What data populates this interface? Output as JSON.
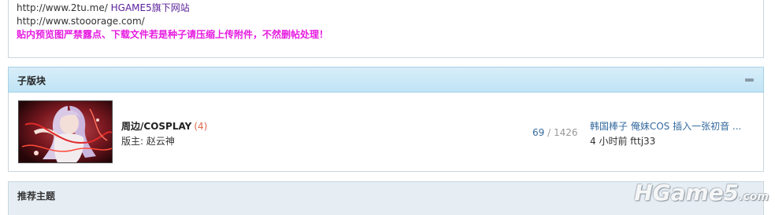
{
  "notice": {
    "line1_url": "http://www.2tu.me/",
    "line1_label": "HGAME5旗下网站",
    "line2_url": "http://www.stooorage.com/",
    "warning": "贴内预览图严禁露点、下载文件若是种子请压缩上传附件，不然删帖处理！"
  },
  "subforum_section": {
    "title": "子版块"
  },
  "forum": {
    "name": "周边/COSPLAY",
    "new_count": "(4)",
    "moderator": "版主: 赵云神",
    "topics": "69",
    "separator": "/",
    "posts": "1426",
    "last_post_title": "韩国棒子 俺妹COS 插入一张初音 ...",
    "last_post_meta": "4 小时前 fttj33"
  },
  "recommend_section": {
    "title": "推荐主题"
  },
  "watermark": {
    "main": "HGame5",
    "suffix": ".com"
  }
}
